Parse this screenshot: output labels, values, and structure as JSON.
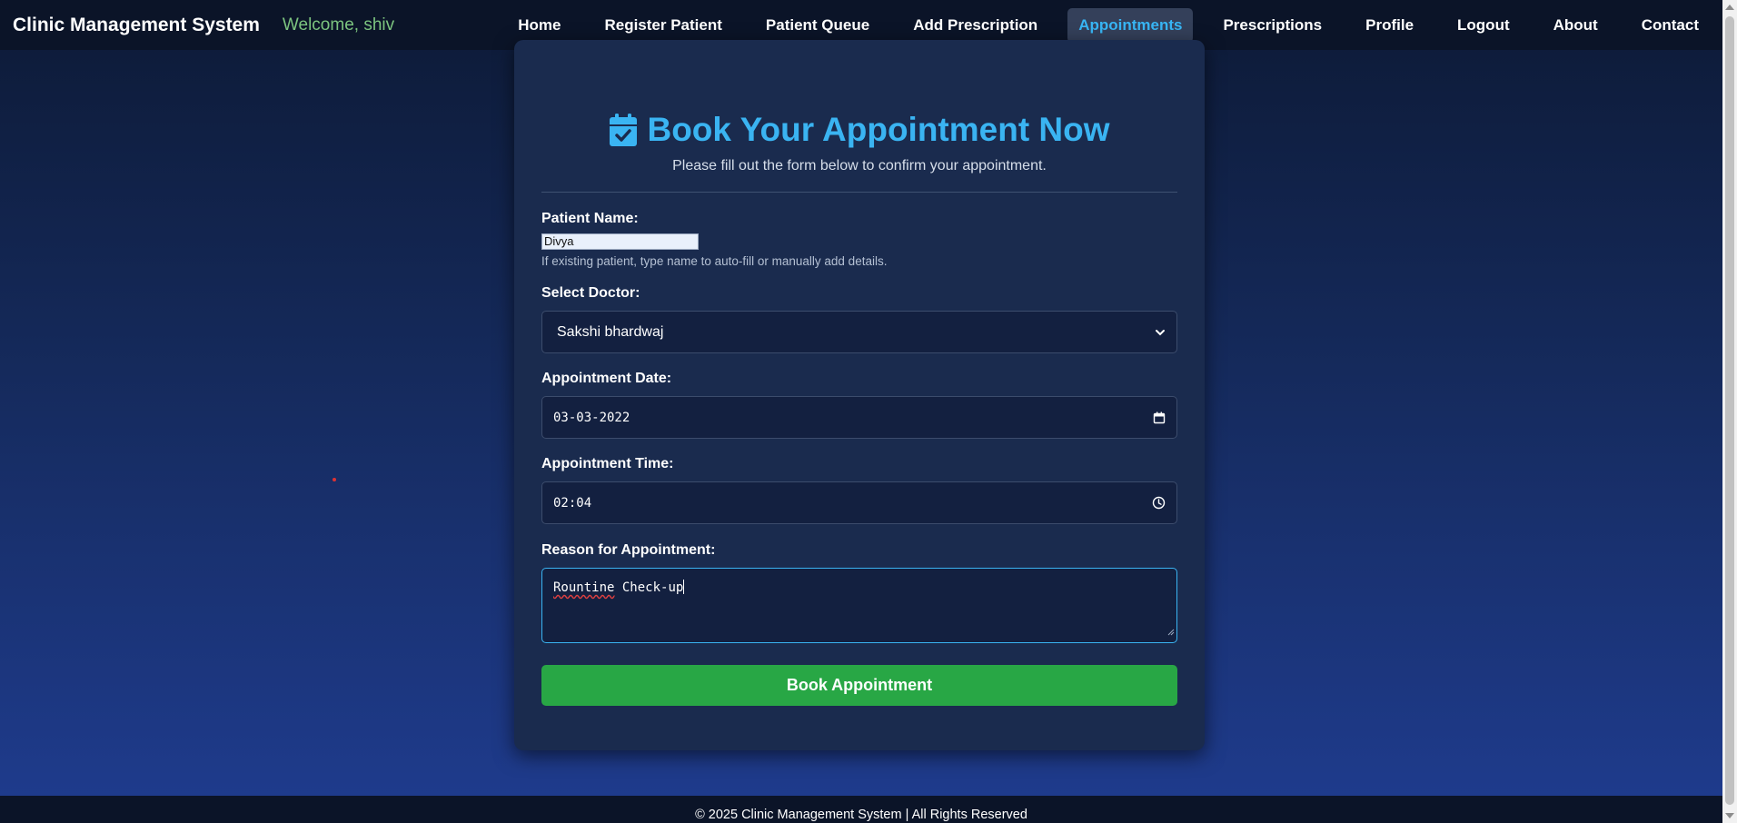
{
  "navbar": {
    "brand": "Clinic Management System",
    "welcome": "Welcome, shiv",
    "links": [
      {
        "label": "Home"
      },
      {
        "label": "Register Patient"
      },
      {
        "label": "Patient Queue"
      },
      {
        "label": "Add Prescription"
      },
      {
        "label": "Appointments",
        "active": true
      },
      {
        "label": "Prescriptions"
      },
      {
        "label": "Profile"
      },
      {
        "label": "Logout"
      },
      {
        "label": "About"
      },
      {
        "label": "Contact"
      }
    ]
  },
  "form": {
    "title": "Book Your Appointment Now",
    "title_icon": "calendar-check-icon",
    "subtitle": "Please fill out the form below to confirm your appointment.",
    "patient_name": {
      "label": "Patient Name:",
      "value": "Divya",
      "hint": "If existing patient, type name to auto-fill or manually add details."
    },
    "doctor": {
      "label": "Select Doctor:",
      "selected": "Sakshi bhardwaj"
    },
    "date": {
      "label": "Appointment Date:",
      "value": "03-03-2022"
    },
    "time": {
      "label": "Appointment Time:",
      "value": "02:04"
    },
    "reason": {
      "label": "Reason for Appointment:",
      "misspelled_word": "Rountine",
      "rest": " Check-up"
    },
    "submit_label": "Book Appointment"
  },
  "footer": {
    "text": "© 2025 Clinic Management System | All Rights Reserved"
  },
  "colors": {
    "accent": "#3ab4f2",
    "button": "#28a745",
    "welcome": "#7cc47f"
  }
}
